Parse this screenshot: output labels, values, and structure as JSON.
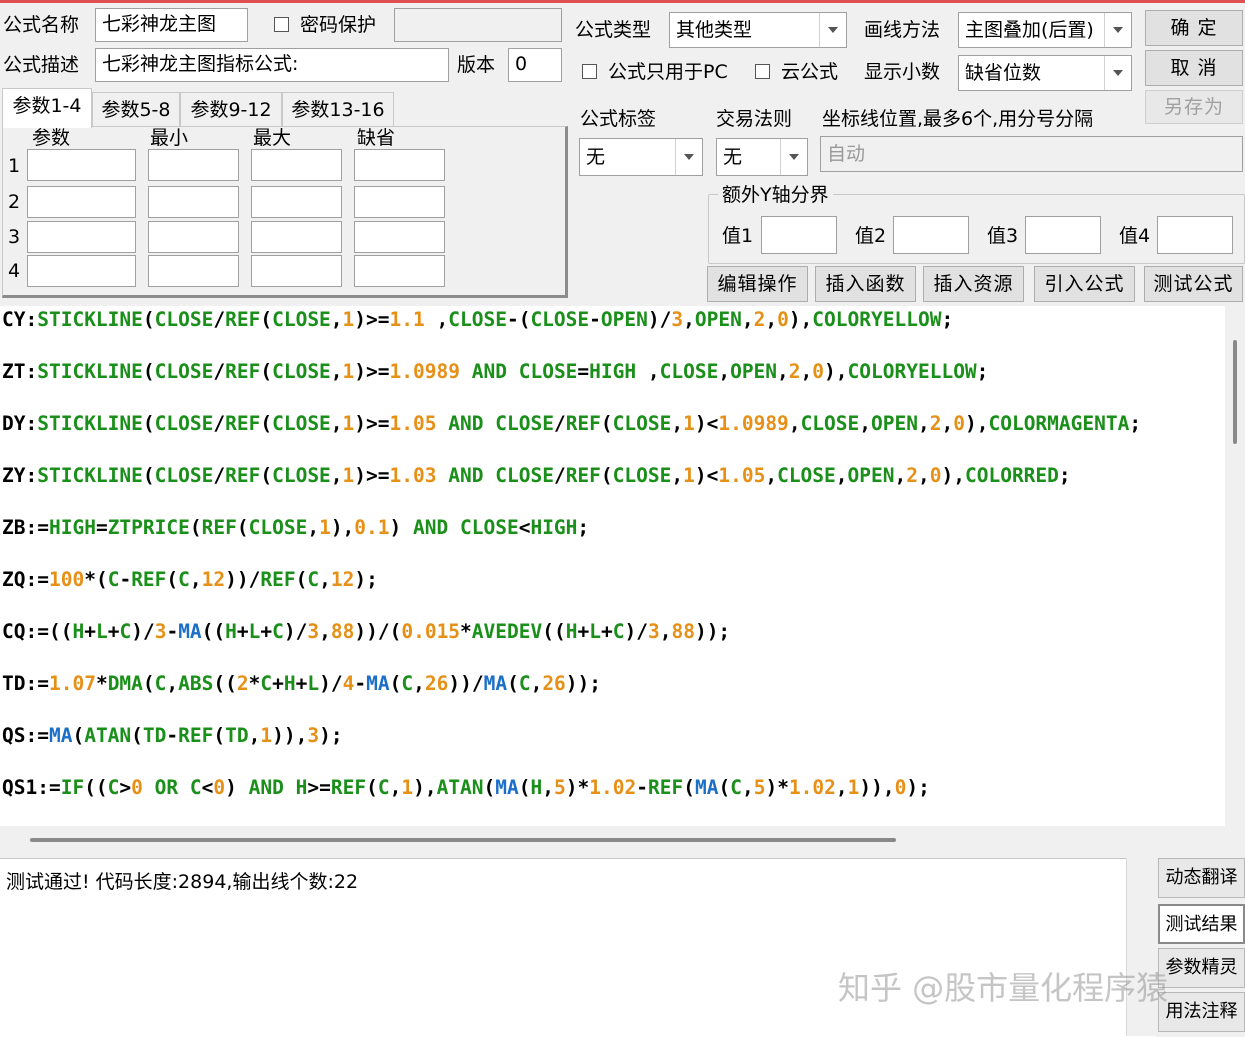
{
  "header": {
    "name_label": "公式名称",
    "name_value": "七彩神龙主图",
    "password_label": "密码保护",
    "password_value": "",
    "desc_label": "公式描述",
    "desc_value": "七彩神龙主图指标公式:",
    "version_label": "版本",
    "version_value": "0",
    "type_label": "公式类型",
    "type_value": "其他类型",
    "draw_label": "画线方法",
    "draw_value": "主图叠加(后置)",
    "pc_only_label": "公式只用于PC",
    "cloud_label": "云公式",
    "decimal_label": "显示小数",
    "decimal_value": "缺省位数"
  },
  "buttons": {
    "ok": "确  定",
    "cancel": "取  消",
    "save_as": "另存为",
    "edit": "编辑操作",
    "insert_func": "插入函数",
    "insert_res": "插入资源",
    "import": "引入公式",
    "test": "测试公式"
  },
  "tabs": [
    "参数1-4",
    "参数5-8",
    "参数9-12",
    "参数13-16"
  ],
  "params": {
    "headers": [
      "参数",
      "最小",
      "最大",
      "缺省"
    ],
    "rows": [
      "1",
      "2",
      "3",
      "4"
    ]
  },
  "options": {
    "tag_label": "公式标签",
    "tag_value": "无",
    "rule_label": "交易法则",
    "rule_value": "无",
    "axis_label": "坐标线位置,最多6个,用分号分隔",
    "axis_value": "自动",
    "yaxis_group": "额外Y轴分界",
    "v1": "值1",
    "v2": "值2",
    "v3": "值3",
    "v4": "值4"
  },
  "code_lines": [
    "CY:STICKLINE(CLOSE/REF(CLOSE,1)>=1.1 ,CLOSE-(CLOSE-OPEN)/3,OPEN,2,0),COLORYELLOW;",
    "ZT:STICKLINE(CLOSE/REF(CLOSE,1)>=1.0989 AND CLOSE=HIGH ,CLOSE,OPEN,2,0),COLORYELLOW;",
    "DY:STICKLINE(CLOSE/REF(CLOSE,1)>=1.05 AND CLOSE/REF(CLOSE,1)<1.0989,CLOSE,OPEN,2,0),COLORMAGENTA;",
    "ZY:STICKLINE(CLOSE/REF(CLOSE,1)>=1.03 AND CLOSE/REF(CLOSE,1)<1.05,CLOSE,OPEN,2,0),COLORRED;",
    "ZB:=HIGH=ZTPRICE(REF(CLOSE,1),0.1) AND CLOSE<HIGH;",
    "ZQ:=100*(C-REF(C,12))/REF(C,12);",
    "CQ:=((H+L+C)/3-MA((H+L+C)/3,88))/(0.015*AVEDEV((H+L+C)/3,88));",
    "TD:=1.07*DMA(C,ABS((2*C+H+L)/4-MA(C,26))/MA(C,26));",
    "QS:=MA(ATAN(TD-REF(TD,1)),3);",
    "QS1:=IF((C>0 OR C<0) AND H>=REF(C,1),ATAN(MA(H,5)*1.02-REF(MA(C,5)*1.02,1)),0);"
  ],
  "output": {
    "message": "测试通过! 代码长度:2894,输出线个数:22"
  },
  "side_buttons": [
    "动态翻译",
    "测试结果",
    "参数精灵",
    "用法注释"
  ],
  "watermark": "知乎 @股市量化程序猿"
}
